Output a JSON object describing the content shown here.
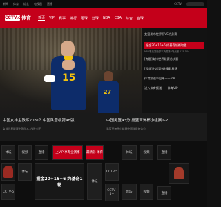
{
  "topbar": {
    "links": [
      "新闻",
      "体育",
      "综艺",
      "电视剧",
      "直播",
      "CCTV"
    ]
  },
  "nav": {
    "logo_text": "CCTV.com",
    "sport_label": "体育",
    "items": [
      "首页",
      "VIP",
      "赛事",
      "排行",
      "足球",
      "篮球",
      "NBA",
      "CBA",
      "综合",
      "台球"
    ]
  },
  "hero": {
    "jersey_main": "15",
    "jersey_second": "27",
    "news": [
      {
        "text": "女篮发布世界杯VS热身赛",
        "style": "normal"
      },
      {
        "text": "掘金20+16+6 约基奇领衔取胜",
        "style": "featured"
      },
      {
        "text": "NBA季后赛西部半决赛第2场战报 115-104",
        "style": "sub"
      },
      {
        "text": "[专题]女排世界联赛总决赛",
        "style": "normal"
      },
      {
        "text": "[视频]中超第9轮精彩集锦",
        "style": "normal"
      },
      {
        "text": "体育频道节目单——VIP",
        "style": "normal"
      },
      {
        "text": "进入体育频道——体育VIP",
        "style": "normal"
      }
    ]
  },
  "stories": [
    {
      "title": "中国女排主教练2031？中国队晋级第48强",
      "sub": "女排世界联赛中国队3-1战胜对手"
    },
    {
      "title": "中国男篮43分 男篮亚洲杯小组赛1-2",
      "sub": "男篮亚洲杯小组赛中国队遗憾告负"
    }
  ],
  "grid": {
    "cells": [
      "体坛",
      "视频",
      "直播",
      "上VIP 享专业赛事",
      "最精彩 体育",
      "体坛",
      "视频",
      "直播",
      "CCTV-5",
      "体坛",
      "掘金20+16+6 约基奇1轮",
      "体坛",
      "CCTV-5+",
      "CCTV-5",
      "体坛",
      "视频",
      "直播"
    ]
  },
  "colors": {
    "brand_red": "#c4001a",
    "jersey_navy": "#0d2c6a",
    "jersey_gold": "#f2c10e"
  }
}
